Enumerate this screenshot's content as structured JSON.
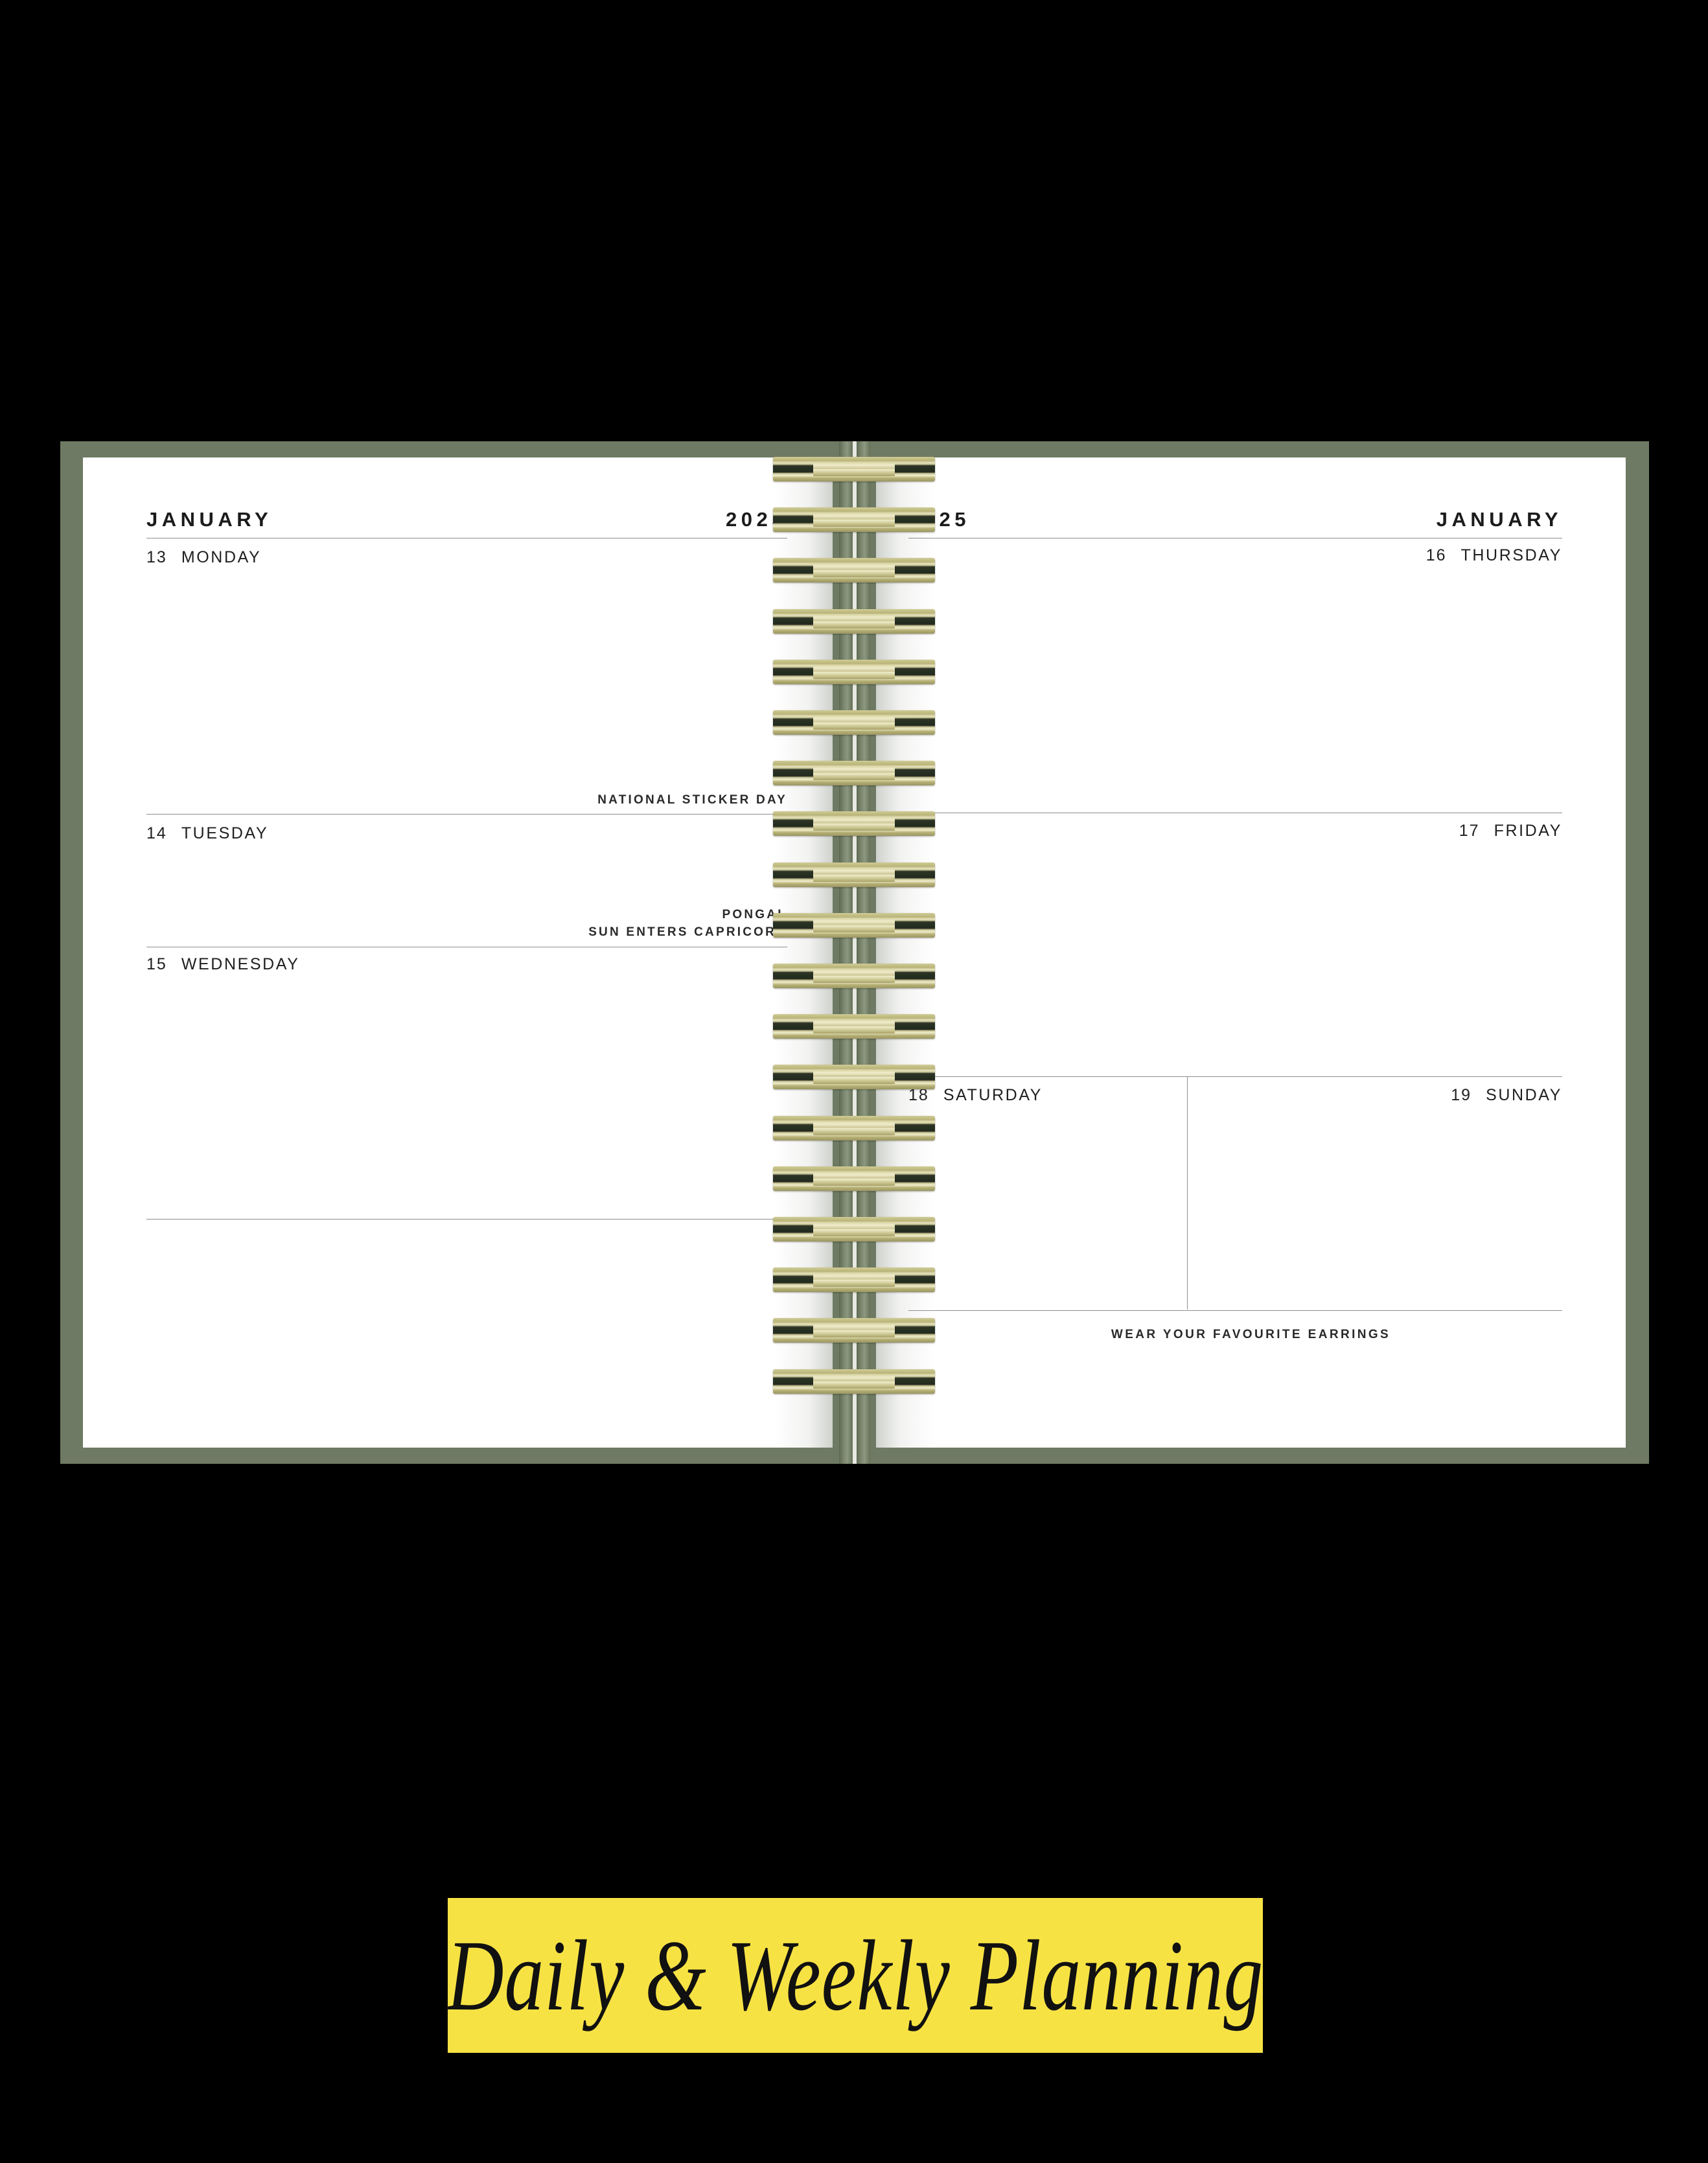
{
  "product": {
    "cover_color": "#6e7a63",
    "spiral_color": "#c9c48f",
    "page_color": "#ffffff"
  },
  "caption": {
    "text": "Daily & Weekly Planning",
    "background_color": "#f7e244",
    "text_color": "#111111"
  },
  "left_page": {
    "header": {
      "month": "JANUARY",
      "year": "2025"
    },
    "days": [
      {
        "number": "13",
        "name": "MONDAY"
      },
      {
        "number": "14",
        "name": "TUESDAY"
      },
      {
        "number": "15",
        "name": "WEDNESDAY"
      }
    ],
    "notes": [
      {
        "text": "NATIONAL STICKER DAY"
      },
      {
        "text": "PONGAL"
      },
      {
        "text": "SUN ENTERS CAPRICORN"
      }
    ]
  },
  "right_page": {
    "header": {
      "year": "2025",
      "month": "JANUARY"
    },
    "days": [
      {
        "number": "16",
        "name": "THURSDAY"
      },
      {
        "number": "17",
        "name": "FRIDAY"
      },
      {
        "number": "18",
        "name": "SATURDAY"
      },
      {
        "number": "19",
        "name": "SUNDAY"
      }
    ],
    "notes": [
      {
        "text": "WEAR YOUR FAVOURITE EARRINGS"
      }
    ]
  }
}
